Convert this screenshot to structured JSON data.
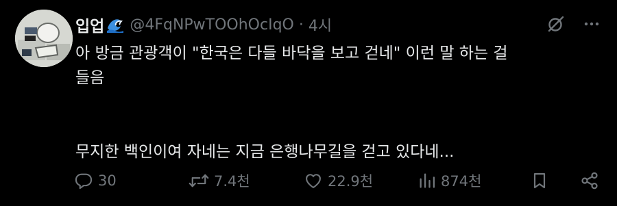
{
  "author": {
    "display_name": "입업",
    "handle": "@4FqNPwTOOhOcIqO",
    "separator": "·",
    "time": "4시"
  },
  "tweet": {
    "lines": [
      "아 방금 관광객이 \"한국은 다들 바닥을 보고 걷네\" 이런 말 하는 걸",
      "들음",
      "무지한 백인이여 자네는 지금 은행나무길을 걷고 있다네..."
    ]
  },
  "actions": {
    "reply_count": "30",
    "repost_count": "7.4천",
    "like_count": "22.9천",
    "views_count": "874천"
  },
  "icons": {
    "name_emoji": "wave-icon",
    "grok": "grok-icon",
    "more": "more-icon",
    "reply": "reply-icon",
    "repost": "repost-icon",
    "like": "like-icon",
    "views": "views-icon",
    "bookmark": "bookmark-icon",
    "share": "share-icon"
  },
  "colors": {
    "background": "#000000",
    "text": "#e7e9ea",
    "muted": "#71767b"
  }
}
